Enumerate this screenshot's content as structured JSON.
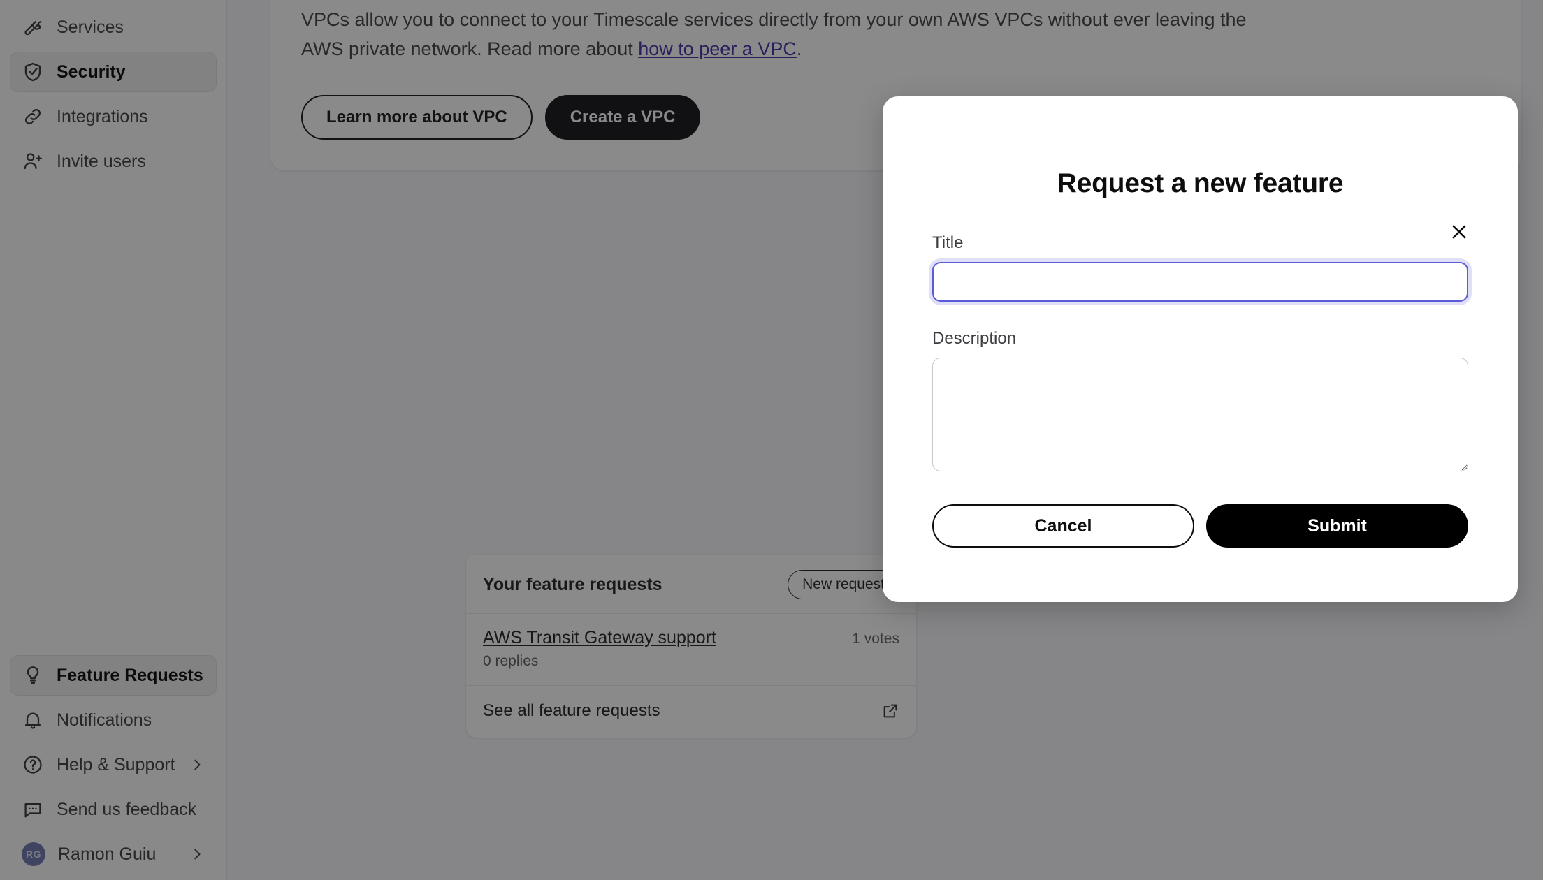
{
  "sidebar": {
    "top_items": [
      {
        "label": "Services",
        "icon": "wrench-icon",
        "active": false,
        "chevron": false
      },
      {
        "label": "Security",
        "icon": "shield-check-icon",
        "active": true,
        "chevron": false
      },
      {
        "label": "Integrations",
        "icon": "link-icon",
        "active": false,
        "chevron": false
      },
      {
        "label": "Invite users",
        "icon": "user-plus-icon",
        "active": false,
        "chevron": false
      }
    ],
    "bottom_items": [
      {
        "label": "Feature Requests",
        "icon": "lightbulb-icon",
        "active": true,
        "chevron": false
      },
      {
        "label": "Notifications",
        "icon": "bell-icon",
        "active": false,
        "chevron": false
      },
      {
        "label": "Help & Support",
        "icon": "question-mark-circle-icon",
        "active": false,
        "chevron": true
      },
      {
        "label": "Send us feedback",
        "icon": "chat-bubble-icon",
        "active": false,
        "chevron": false
      },
      {
        "label": "Ramon Guiu",
        "icon": "avatar",
        "active": false,
        "chevron": true,
        "initials": "RG"
      }
    ]
  },
  "vpc_card": {
    "description_part1": "VPCs allow you to connect to your Timescale services directly from your own AWS VPCs without ever leaving the AWS private network. Read more about ",
    "link_text": "how to peer a VPC",
    "description_part2": ".",
    "learn_more_label": "Learn more about VPC",
    "create_label": "Create a VPC"
  },
  "feature_requests": {
    "header_title": "Your feature requests",
    "new_request_label": "New request",
    "items": [
      {
        "title": "AWS Transit Gateway support",
        "votes": "1 votes",
        "replies": "0 replies"
      }
    ],
    "see_all_label": "See all feature requests",
    "see_all_icon": "external-link-icon"
  },
  "modal": {
    "title": "Request a new feature",
    "close_icon": "close-icon",
    "title_field": {
      "label": "Title",
      "value": "",
      "placeholder": ""
    },
    "description_field": {
      "label": "Description",
      "value": "",
      "placeholder": ""
    },
    "cancel_label": "Cancel",
    "submit_label": "Submit"
  },
  "colors": {
    "accent_focus_border": "#5b5bd6",
    "accent_focus_ring": "#dfe0f7",
    "link": "#3b2a9e",
    "primary_button_bg": "#000000",
    "avatar_bg": "#6b72a8",
    "overlay": "rgba(22,22,24,0.50)"
  }
}
